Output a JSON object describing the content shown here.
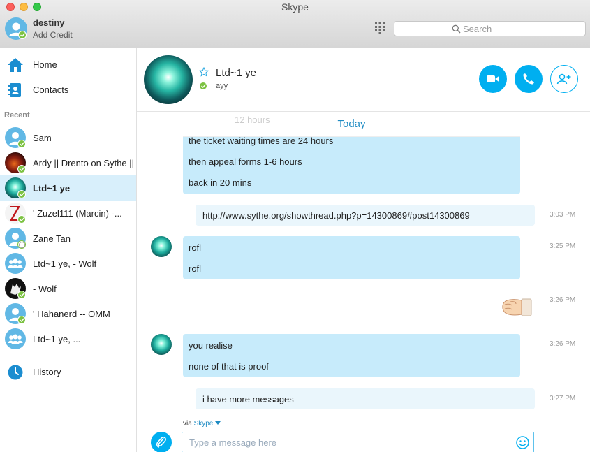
{
  "window": {
    "title": "Skype"
  },
  "me": {
    "name": "destiny",
    "subtitle": "Add Credit",
    "status": "online"
  },
  "search": {
    "placeholder": "Search"
  },
  "nav": {
    "home": "Home",
    "contacts": "Contacts",
    "recent_label": "Recent",
    "history": "History"
  },
  "recent": [
    {
      "name": "Sam",
      "status": "online",
      "avatar": "default-person"
    },
    {
      "name": "Ardy || Drento on Sythe ||",
      "status": "online",
      "avatar": "photo-red"
    },
    {
      "name": "Ltd~1 ye",
      "status": "online",
      "avatar": "photo-teal",
      "selected": true
    },
    {
      "name": "' Zuzel111 (Marcin) -...",
      "status": "online",
      "avatar": "photo-z"
    },
    {
      "name": "Zane Tan",
      "status": "offline",
      "avatar": "default-person"
    },
    {
      "name": "Ltd~1 ye, - Wolf",
      "status": "none",
      "avatar": "group"
    },
    {
      "name": "- Wolf",
      "status": "online",
      "avatar": "photo-wolf"
    },
    {
      "name": "' Hahanerd -- OMM",
      "status": "online",
      "avatar": "default-person"
    },
    {
      "name": "Ltd~1 ye, ...",
      "status": "none",
      "avatar": "group"
    }
  ],
  "chat": {
    "name": "Ltd~1 ye",
    "mood": "ayy",
    "status": "online",
    "today_label": "Today",
    "faded_text": "12 hours",
    "messages": [
      {
        "lines": [
          "the  ticket waiting times are 24 hours",
          "then appeal forms 1-6 hours",
          " back in 20 mins"
        ],
        "time": ""
      },
      {
        "lines": [
          "http://www.sythe.org/showthread.php?p=14300869#post14300869"
        ],
        "time": "3:03 PM",
        "outgoing": true,
        "link": true
      },
      {
        "lines": [
          "rofl",
          "rofl"
        ],
        "time": "3:25 PM"
      },
      {
        "lines": [],
        "time": "3:26 PM",
        "outgoing": true,
        "emoticon": "fist-bump"
      },
      {
        "lines": [
          "you realise",
          "none of that is proof"
        ],
        "time": "3:26 PM"
      },
      {
        "lines": [
          "i have more messages"
        ],
        "time": "3:27 PM",
        "outgoing": true
      }
    ]
  },
  "composer": {
    "via_prefix": "via",
    "via_service": "Skype",
    "placeholder": "Type a message here"
  },
  "colors": {
    "accent": "#00aff0",
    "online": "#7cc242",
    "bubble": "#c7ebfb",
    "selected_row": "#d8effb"
  }
}
